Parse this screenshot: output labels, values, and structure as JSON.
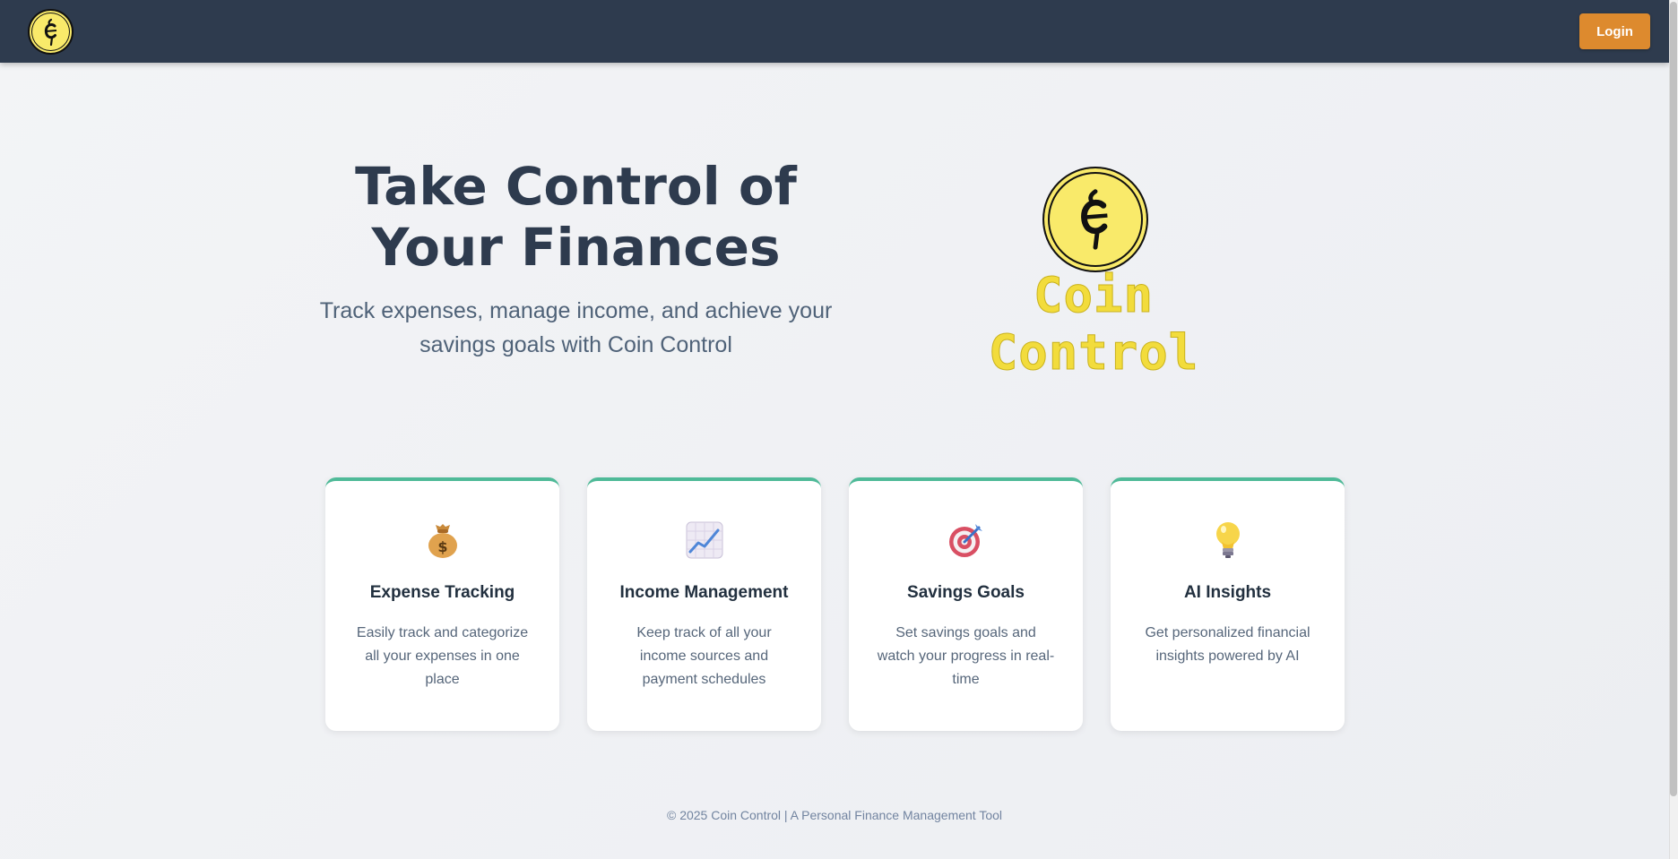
{
  "header": {
    "logo_icon": "coin-control-logo-icon",
    "login_label": "Login"
  },
  "hero": {
    "title_line1": "Take Control of",
    "title_line2": "Your Finances",
    "subtitle_line1": "Track expenses, manage income, and achieve your",
    "subtitle_line2": "savings goals with Coin Control",
    "brand_name": "Coin Control"
  },
  "features": [
    {
      "icon": "money-bag-icon",
      "title": "Expense Tracking",
      "description": "Easily track and categorize all your expenses in one place"
    },
    {
      "icon": "chart-increasing-icon",
      "title": "Income Management",
      "description": "Keep track of all your income sources and payment schedules"
    },
    {
      "icon": "target-icon",
      "title": "Savings Goals",
      "description": "Set savings goals and watch your progress in real-time"
    },
    {
      "icon": "light-bulb-icon",
      "title": "AI Insights",
      "description": "Get personalized financial insights powered by AI"
    }
  ],
  "footer": {
    "text": "© 2025 Coin Control | A Personal Finance Management Tool"
  },
  "colors": {
    "navbar": "#2e3b4e",
    "login_button": "#dd8a2e",
    "card_accent": "#4fba98",
    "brand_yellow": "#f2dc3c"
  }
}
